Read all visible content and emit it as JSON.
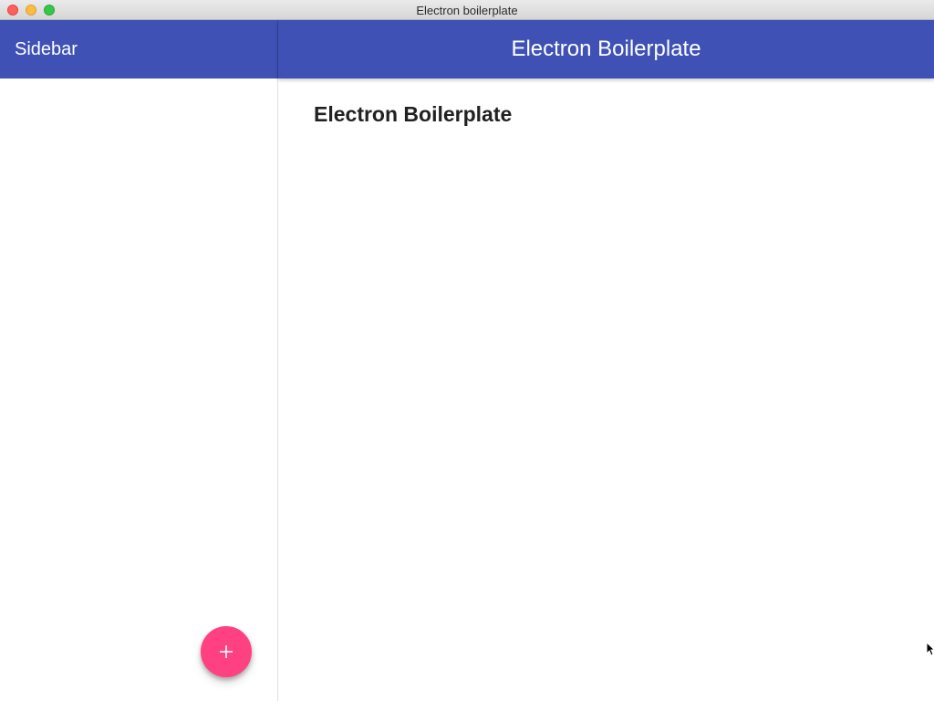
{
  "window": {
    "title": "Electron boilerplate"
  },
  "sidebar": {
    "title": "Sidebar",
    "fab": {
      "icon": "plus-icon",
      "color": "#ff4081"
    }
  },
  "appbar": {
    "title": "Electron Boilerplate",
    "color": "#3f51b5"
  },
  "content": {
    "heading": "Electron Boilerplate"
  }
}
